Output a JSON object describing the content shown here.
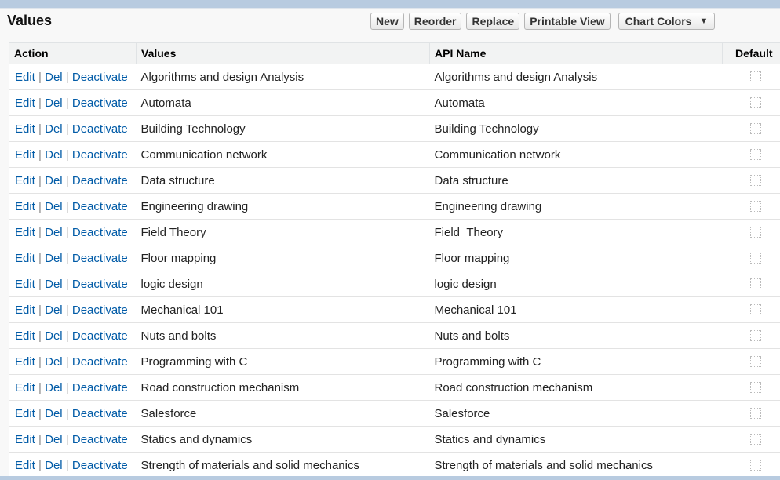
{
  "section_title": "Values",
  "toolbar": {
    "new_label": "New",
    "reorder_label": "Reorder",
    "replace_label": "Replace",
    "printable_view_label": "Printable View",
    "chart_colors_label": "Chart Colors"
  },
  "columns": {
    "action": "Action",
    "values": "Values",
    "api_name": "API Name",
    "default": "Default"
  },
  "actions": {
    "edit": "Edit",
    "del": "Del",
    "deactivate": "Deactivate",
    "separator": "|"
  },
  "rows": [
    {
      "value": "Algorithms and design Analysis",
      "api_name": "Algorithms and design Analysis",
      "default": false
    },
    {
      "value": "Automata",
      "api_name": "Automata",
      "default": false
    },
    {
      "value": "Building Technology",
      "api_name": "Building Technology",
      "default": false
    },
    {
      "value": "Communication network",
      "api_name": "Communication network",
      "default": false
    },
    {
      "value": "Data structure",
      "api_name": "Data structure",
      "default": false
    },
    {
      "value": "Engineering drawing",
      "api_name": "Engineering drawing",
      "default": false
    },
    {
      "value": "Field Theory",
      "api_name": "Field_Theory",
      "default": false
    },
    {
      "value": "Floor mapping",
      "api_name": "Floor mapping",
      "default": false
    },
    {
      "value": "logic design",
      "api_name": "logic design",
      "default": false
    },
    {
      "value": "Mechanical 101",
      "api_name": "Mechanical 101",
      "default": false
    },
    {
      "value": "Nuts and bolts",
      "api_name": "Nuts and bolts",
      "default": false
    },
    {
      "value": "Programming with C",
      "api_name": "Programming with C",
      "default": false
    },
    {
      "value": "Road construction mechanism",
      "api_name": "Road construction mechanism",
      "default": false
    },
    {
      "value": "Salesforce",
      "api_name": "Salesforce",
      "default": false
    },
    {
      "value": "Statics and dynamics",
      "api_name": "Statics and dynamics",
      "default": false
    },
    {
      "value": "Strength of materials and solid mechanics",
      "api_name": "Strength of materials and solid mechanics",
      "default": false
    }
  ]
}
